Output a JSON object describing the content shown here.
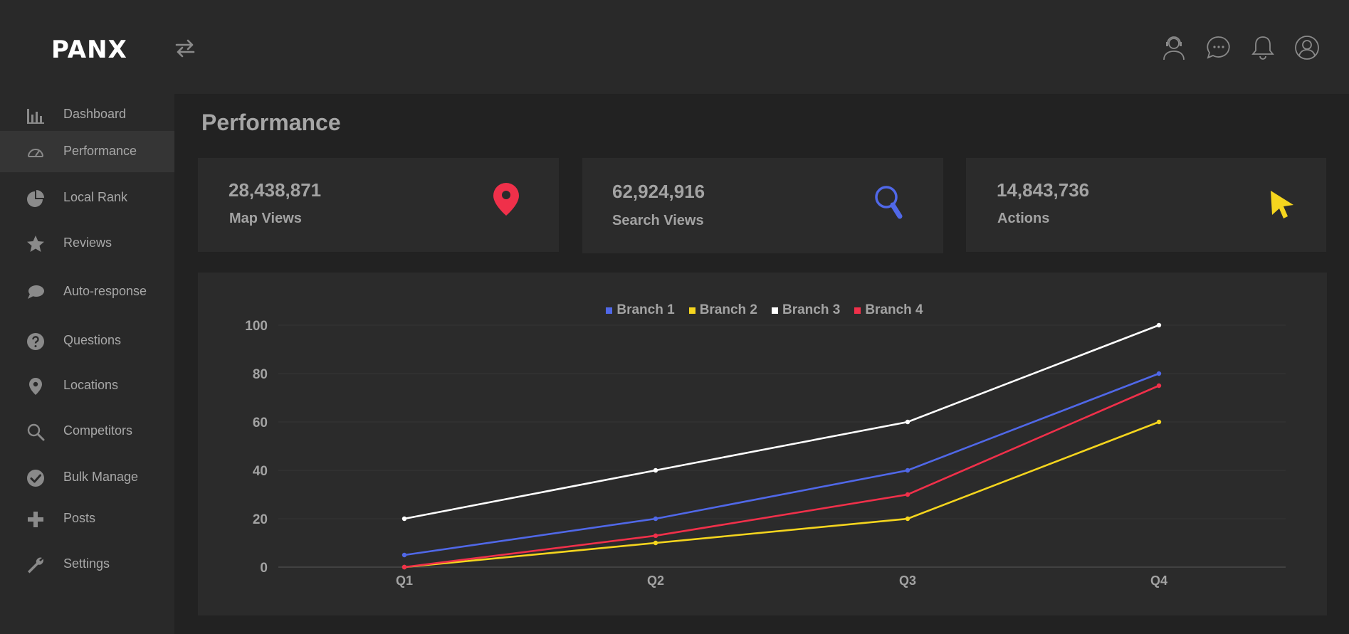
{
  "app": {
    "logo_text": "PANX"
  },
  "header": {
    "icons": [
      "support-agent-icon",
      "chat-bubble-icon",
      "bell-icon",
      "user-profile-icon"
    ]
  },
  "sidebar": {
    "items": [
      {
        "label": "Dashboard",
        "icon": "bar-chart-icon",
        "active": false
      },
      {
        "label": "Performance",
        "icon": "speedometer-icon",
        "active": true
      },
      {
        "label": "Local Rank",
        "icon": "pie-chart-icon",
        "active": false
      },
      {
        "label": "Reviews",
        "icon": "star-icon",
        "active": false
      },
      {
        "label": "Auto-response",
        "icon": "speech-bubble-icon",
        "active": false
      },
      {
        "label": "Questions",
        "icon": "question-circle-icon",
        "active": false
      },
      {
        "label": "Locations",
        "icon": "map-pin-icon",
        "active": false
      },
      {
        "label": "Competitors",
        "icon": "search-icon",
        "active": false
      },
      {
        "label": "Bulk Manage",
        "icon": "check-circle-icon",
        "active": false
      },
      {
        "label": "Posts",
        "icon": "plus-icon",
        "active": false
      },
      {
        "label": "Settings",
        "icon": "wrench-icon",
        "active": false
      }
    ]
  },
  "main": {
    "title": "Performance",
    "cards": [
      {
        "value": "28,438,871",
        "label": "Map Views",
        "icon": "map-pin-icon",
        "color": "#f0304a"
      },
      {
        "value": "62,924,916",
        "label": "Search Views",
        "icon": "magnifier-icon",
        "color": "#5068e8"
      },
      {
        "value": "14,843,736",
        "label": "Actions",
        "icon": "cursor-icon",
        "color": "#f5d51e"
      }
    ]
  },
  "chart_data": {
    "type": "line",
    "categories": [
      "Q1",
      "Q2",
      "Q3",
      "Q4"
    ],
    "series": [
      {
        "name": "Branch 1",
        "color": "#5068e8",
        "values": [
          5,
          20,
          40,
          80
        ]
      },
      {
        "name": "Branch 2",
        "color": "#f5d51e",
        "values": [
          0,
          10,
          20,
          60
        ]
      },
      {
        "name": "Branch 3",
        "color": "#ffffff",
        "values": [
          20,
          40,
          60,
          100
        ]
      },
      {
        "name": "Branch 4",
        "color": "#f0304a",
        "values": [
          0,
          13,
          30,
          75
        ]
      }
    ],
    "yticks": [
      "0",
      "20",
      "40",
      "60",
      "80",
      "100"
    ],
    "ylim": [
      0,
      100
    ],
    "legend": "top-center",
    "grid": true
  }
}
